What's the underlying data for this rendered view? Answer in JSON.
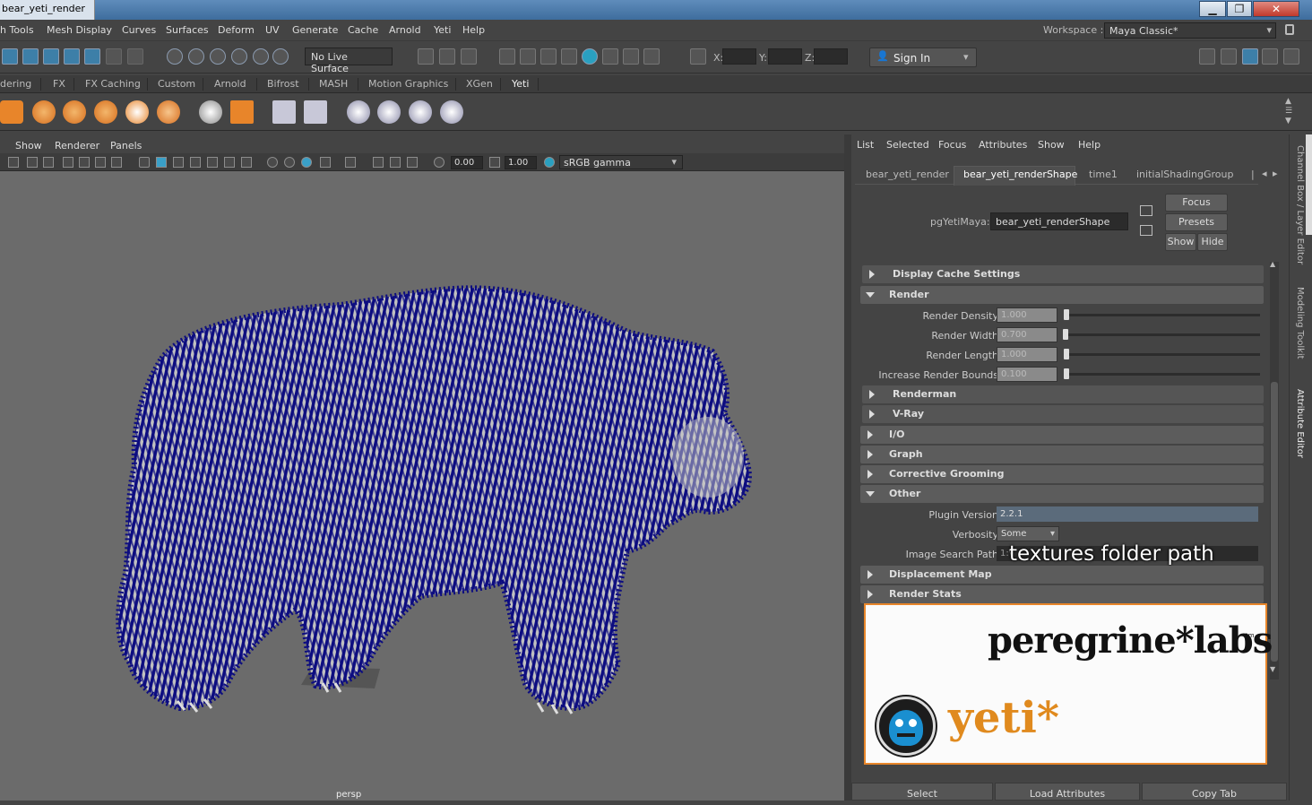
{
  "window": {
    "title": "bear_yeti_render",
    "min": "▁",
    "max": "❐",
    "close": "✕"
  },
  "menubar": {
    "items": [
      "h Tools",
      "Mesh Display",
      "Curves",
      "Surfaces",
      "Deform",
      "UV",
      "Generate",
      "Cache",
      "Arnold",
      "Yeti",
      "Help"
    ],
    "workspace_label": "Workspace :",
    "workspace_value": "Maya Classic*"
  },
  "toolbar": {
    "live_surface": "No Live Surface",
    "x_label": "X:",
    "y_label": "Y:",
    "z_label": "Z:",
    "sign_in": "Sign In"
  },
  "shelf": {
    "tabs": [
      "dering",
      "FX",
      "FX Caching",
      "Custom",
      "Arnold",
      "Bifrost",
      "MASH",
      "Motion Graphics",
      "XGen",
      "Yeti"
    ]
  },
  "viewport": {
    "menus": [
      "Show",
      "Renderer",
      "Panels"
    ],
    "exposure": "0.00",
    "gamma": "1.00",
    "color_space": "sRGB gamma",
    "camera_label": "persp",
    "fur_color": "#0d0d80",
    "body_color": "#bfbfbf"
  },
  "attribute_editor": {
    "menus": [
      "List",
      "Selected",
      "Focus",
      "Attributes",
      "Show",
      "Help"
    ],
    "tabs": [
      "bear_yeti_render",
      "bear_yeti_renderShape",
      "time1",
      "initialShadingGroup"
    ],
    "node_label": "pgYetiMaya:",
    "node_value": "bear_yeti_renderShape",
    "buttons": {
      "focus": "Focus",
      "presets": "Presets",
      "show": "Show",
      "hide": "Hide"
    },
    "sections": {
      "display_cache": "Display Cache Settings",
      "render": "Render",
      "renderman": "Renderman",
      "vray": "V-Ray",
      "io": "I/O",
      "graph": "Graph",
      "corrective": "Corrective Grooming",
      "other": "Other",
      "displacement": "Displacement Map",
      "render_stats": "Render Stats"
    },
    "render_attrs": [
      {
        "label": "Render Density",
        "value": "1.000",
        "fraction": 0.0
      },
      {
        "label": "Render Width",
        "value": "0.700",
        "fraction": 0.0
      },
      {
        "label": "Render Length",
        "value": "1.000",
        "fraction": 0.0
      },
      {
        "label": "Increase Render Bounds",
        "value": "0.100",
        "fraction": 0.0
      }
    ],
    "other": {
      "plugin_label": "Plugin Version",
      "plugin_value": "2.2.1",
      "verbosity_label": "Verbosity",
      "verbosity_value": "Some",
      "image_path_label": "Image Search Path",
      "image_path_value": "1:\\"
    },
    "overlay_caption": "textures folder path",
    "bottom": {
      "select": "Select",
      "load": "Load Attributes",
      "copy": "Copy Tab"
    }
  },
  "side_tabs": [
    "Channel Box / Layer Editor",
    "Modeling Toolkit",
    "Attribute Editor"
  ],
  "logo": {
    "brand": "peregrine*labs",
    "tm": "tm",
    "product": "yeti*",
    "brand_color": "#111111",
    "product_color": "#e08a1e"
  }
}
